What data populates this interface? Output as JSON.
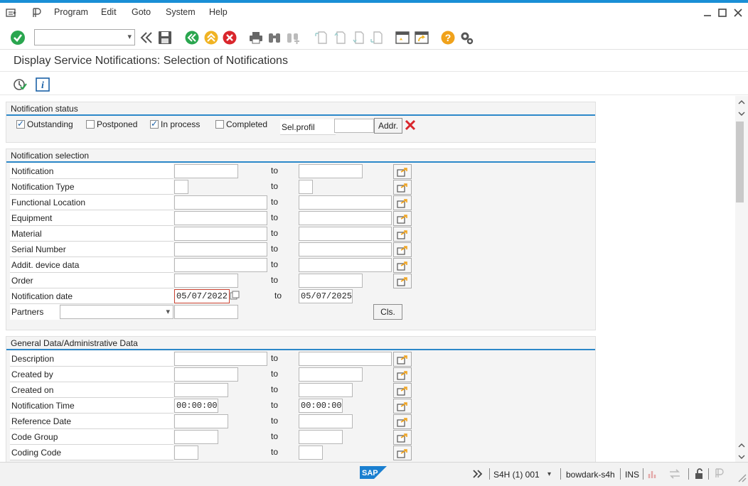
{
  "menubar": {
    "items": [
      "Program",
      "Edit",
      "Goto",
      "System",
      "Help"
    ]
  },
  "titlebar": {
    "title": "Display Service Notifications: Selection of Notifications"
  },
  "notification_status": {
    "title": "Notification status",
    "options": [
      {
        "label": "Outstanding",
        "checked": true
      },
      {
        "label": "Postponed",
        "checked": false
      },
      {
        "label": "In process",
        "checked": true
      },
      {
        "label": "Completed",
        "checked": false
      }
    ],
    "sel_profil_label": "Sel.profil",
    "sel_profil_value": "",
    "addr_button": "Addr."
  },
  "notification_selection": {
    "title": "Notification selection",
    "to_label": "to",
    "rows": [
      {
        "label": "Notification",
        "from": "",
        "to": ""
      },
      {
        "label": "Notification Type",
        "from": "",
        "to": ""
      },
      {
        "label": "Functional Location",
        "from": "",
        "to": ""
      },
      {
        "label": "Equipment",
        "from": "",
        "to": ""
      },
      {
        "label": "Material",
        "from": "",
        "to": ""
      },
      {
        "label": "Serial Number",
        "from": "",
        "to": ""
      },
      {
        "label": "Addit. device data",
        "from": "",
        "to": ""
      },
      {
        "label": "Order",
        "from": "",
        "to": ""
      },
      {
        "label": "Notification date",
        "from": "05/07/2022",
        "to": "05/07/2025"
      }
    ],
    "partners_label": "Partners",
    "partners_value": "",
    "cls_button": "Cls."
  },
  "general_data": {
    "title": "General Data/Administrative Data",
    "to_label": "to",
    "rows": [
      {
        "label": "Description",
        "from": "",
        "to": ""
      },
      {
        "label": "Created by",
        "from": "",
        "to": ""
      },
      {
        "label": "Created on",
        "from": "",
        "to": ""
      },
      {
        "label": "Notification Time",
        "from": "00:00:00",
        "to": "00:00:00"
      },
      {
        "label": "Reference Date",
        "from": "",
        "to": ""
      },
      {
        "label": "Code Group",
        "from": "",
        "to": ""
      },
      {
        "label": "Coding Code",
        "from": "",
        "to": ""
      }
    ]
  },
  "statusbar": {
    "brand": "SAP",
    "system": "S4H (1) 001",
    "server": "bowdark-s4h",
    "mode": "INS"
  },
  "colors": {
    "accent_blue": "#2c88c9",
    "green_ok": "#2aa64f",
    "yellow_nav": "#f0b323",
    "red_cancel": "#d9262c",
    "help_orange": "#f0a21b"
  },
  "icons": [
    "menu-icon",
    "sap-p-icon",
    "enter-icon",
    "back-history-icon",
    "save-icon",
    "back-icon",
    "exit-icon",
    "cancel-icon",
    "print-icon",
    "find-icon",
    "find-next-icon",
    "first-page-icon",
    "prev-page-icon",
    "next-page-icon",
    "last-page-icon",
    "create-session-icon",
    "shortcut-icon",
    "help-icon",
    "settings-icon",
    "execute-icon",
    "info-icon",
    "multiple-selection-icon",
    "delete-icon",
    "minimize-icon",
    "maximize-icon",
    "close-icon"
  ]
}
